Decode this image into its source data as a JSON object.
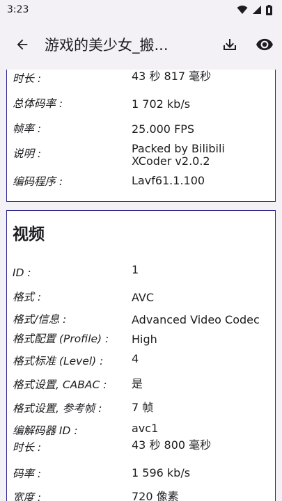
{
  "status": {
    "time": "3:23"
  },
  "appbar": {
    "title": "游戏的美少女_搬..."
  },
  "general": {
    "rows": [
      {
        "label": "时长 :",
        "value": "43 秒 817 毫秒"
      },
      {
        "label": "总体码率 :",
        "value": "1 702 kb/s"
      },
      {
        "label": "帧率 :",
        "value": "25.000 FPS"
      },
      {
        "label": "说明 :",
        "value": "Packed by Bilibili XCoder v2.0.2"
      },
      {
        "label": "编码程序 :",
        "value": "Lavf61.1.100"
      }
    ]
  },
  "video": {
    "title": "视频",
    "rows": [
      {
        "label": "ID :",
        "value": "1"
      },
      {
        "label": "格式 :",
        "value": "AVC"
      },
      {
        "label": "格式/信息 :",
        "value": "Advanced Video Codec"
      },
      {
        "label": "格式配置 (Profile) :",
        "value": "High"
      },
      {
        "label": "格式标准 (Level) :",
        "value": "4"
      },
      {
        "label": "格式设置, CABAC :",
        "value": "是"
      },
      {
        "label": "格式设置, 参考帧 :",
        "value": "7 帧"
      },
      {
        "label": "编解码器 ID :",
        "value": "avc1"
      },
      {
        "label": "时长 :",
        "value": "43 秒 800 毫秒"
      },
      {
        "label": "码率 :",
        "value": "1 596 kb/s"
      },
      {
        "label": "宽度 :",
        "value": "720 像素"
      }
    ]
  },
  "icons": {
    "back": "arrow-back-icon",
    "download": "download-icon",
    "view": "eye-icon"
  }
}
